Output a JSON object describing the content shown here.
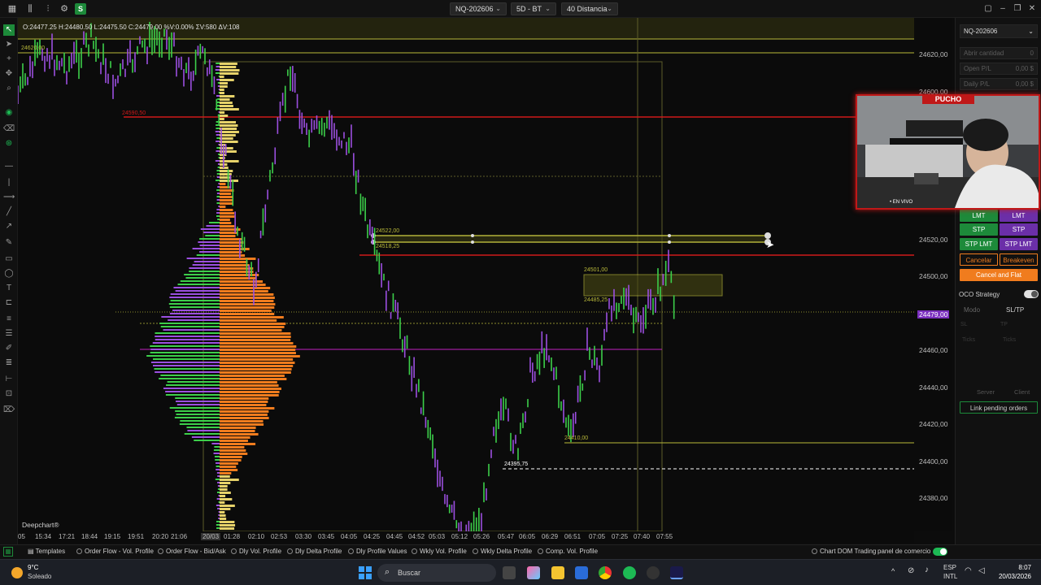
{
  "topbar": {
    "instrument": "NQ-202606",
    "timeframe": "5D - BT",
    "bars_type": "40 Distancia"
  },
  "ohlc_readout": "O:24477.25 H:24480.50 L:24475.50 C:24479.00 %V:0.00% ΣV:580 ΔV:108",
  "chart": {
    "price_labels": [
      "24620,00",
      "24600,00",
      "24520,00",
      "24500,00",
      "24479,00",
      "24460,00",
      "24440,00",
      "24420,00",
      "24400,00",
      "24380,00"
    ],
    "time_labels": [
      "05",
      "15:34",
      "17:21",
      "18:44",
      "19:15",
      "19:51",
      "20:20",
      "21:06",
      "20/03",
      "01:28",
      "02:10",
      "02:53",
      "03:30",
      "03:45",
      "04:05",
      "04:25",
      "04:45",
      "04:52",
      "05:03",
      "05:12",
      "05:26",
      "05:47",
      "06:05",
      "06:29",
      "06:51",
      "07:05",
      "07:25",
      "07:40",
      "07:55"
    ],
    "annotations": {
      "rect_upper_price": "24501,00",
      "rect_lower_price": "24485,25",
      "line_522": "24522,00",
      "line_518": "24518,25",
      "line_410": "24410,00",
      "line_395": "24395,75",
      "top_left_price": "24620,00",
      "red_line_price": "24590,50"
    },
    "watermark": "Deepchart®",
    "current_price": "24479,00"
  },
  "right_panel": {
    "instrument": "NQ-202606",
    "fields": [
      {
        "label": "Abrir cantidad",
        "value": "0"
      },
      {
        "label": "Open P/L",
        "value": "0,00 $"
      },
      {
        "label": "Daily P/L",
        "value": "0,00 $"
      }
    ],
    "buttons": {
      "lmt_buy": "LMT",
      "lmt_sell": "LMT",
      "stp_buy": "STP",
      "stp_sell": "STP",
      "stplmt_buy": "STP LMT",
      "stplmt_sell": "STP LMT",
      "cancel": "Cancelar",
      "breakeven": "Breakeven",
      "cancel_flat": "Cancel and Flat"
    },
    "oco_label": "OCO Strategy",
    "mode_label": "Modo",
    "mode_value": "SL/TP",
    "sl": "SL",
    "tp": "TP",
    "ticks1": "Ticks",
    "ticks2": "Ticks",
    "server": "Server",
    "client": "Client",
    "link_orders": "Link pending orders"
  },
  "webcam": {
    "title": "PUCHO",
    "live": "• EN VIVO"
  },
  "bottom_bar": {
    "templates": "Templates",
    "tabs": [
      "Order Flow - Vol. Profile",
      "Order Flow - Bid/Ask",
      "Dly Vol. Profile",
      "Dly Delta Profile",
      "Dly Profile Values",
      "Wkly Vol. Profile",
      "Wkly Delta Profile",
      "Comp. Vol. Profile"
    ],
    "chart_dom": "Chart DOM Trading",
    "panel": "panel de comercio"
  },
  "taskbar": {
    "temp": "9°C",
    "weather": "Soleado",
    "search_placeholder": "Buscar",
    "lang": "ESP",
    "lang2": "INTL",
    "time": "8:07",
    "date": "20/03/2026"
  },
  "colors": {
    "accent_green": "#1d8a3a",
    "accent_purple": "#6b2fa8",
    "orange": "#f07c1e",
    "red_line": "#d01a1a",
    "yellow_line": "#b9b93a"
  }
}
